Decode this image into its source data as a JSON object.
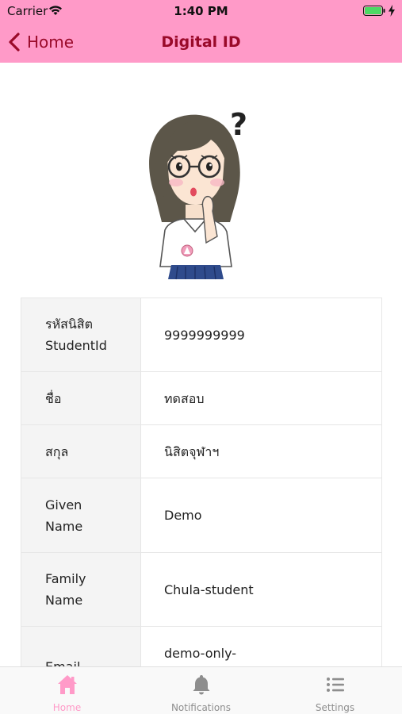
{
  "status_bar": {
    "carrier": "Carrier",
    "time": "1:40 PM",
    "battery_level": 1.0,
    "battery_color": "#4cd964"
  },
  "nav": {
    "back_label": "Home",
    "title": "Digital ID",
    "bar_color": "#ff9ac8",
    "tint_color": "#9a0a2a"
  },
  "avatar": {
    "icon": "student-avatar-illustration",
    "mark": "?"
  },
  "info": [
    {
      "label": "รหัสนิสิต\nStudentId",
      "value": "9999999999"
    },
    {
      "label": "ชื่อ",
      "value": "ทดสอบ"
    },
    {
      "label": "สกุล",
      "value": "นิสิตจุฬาฯ"
    },
    {
      "label": "Given\nName",
      "value": "Demo"
    },
    {
      "label": "Family\nName",
      "value": "Chula-student"
    },
    {
      "label": "Email",
      "value": "demo-only-"
    }
  ],
  "tabs": [
    {
      "label": "Home",
      "icon": "home-icon",
      "active": true
    },
    {
      "label": "Notifications",
      "icon": "bell-icon",
      "active": false
    },
    {
      "label": "Settings",
      "icon": "list-icon",
      "active": false
    }
  ],
  "colors": {
    "active_tab": "#ff9ac8",
    "inactive_tab": "#8e8e8e"
  }
}
